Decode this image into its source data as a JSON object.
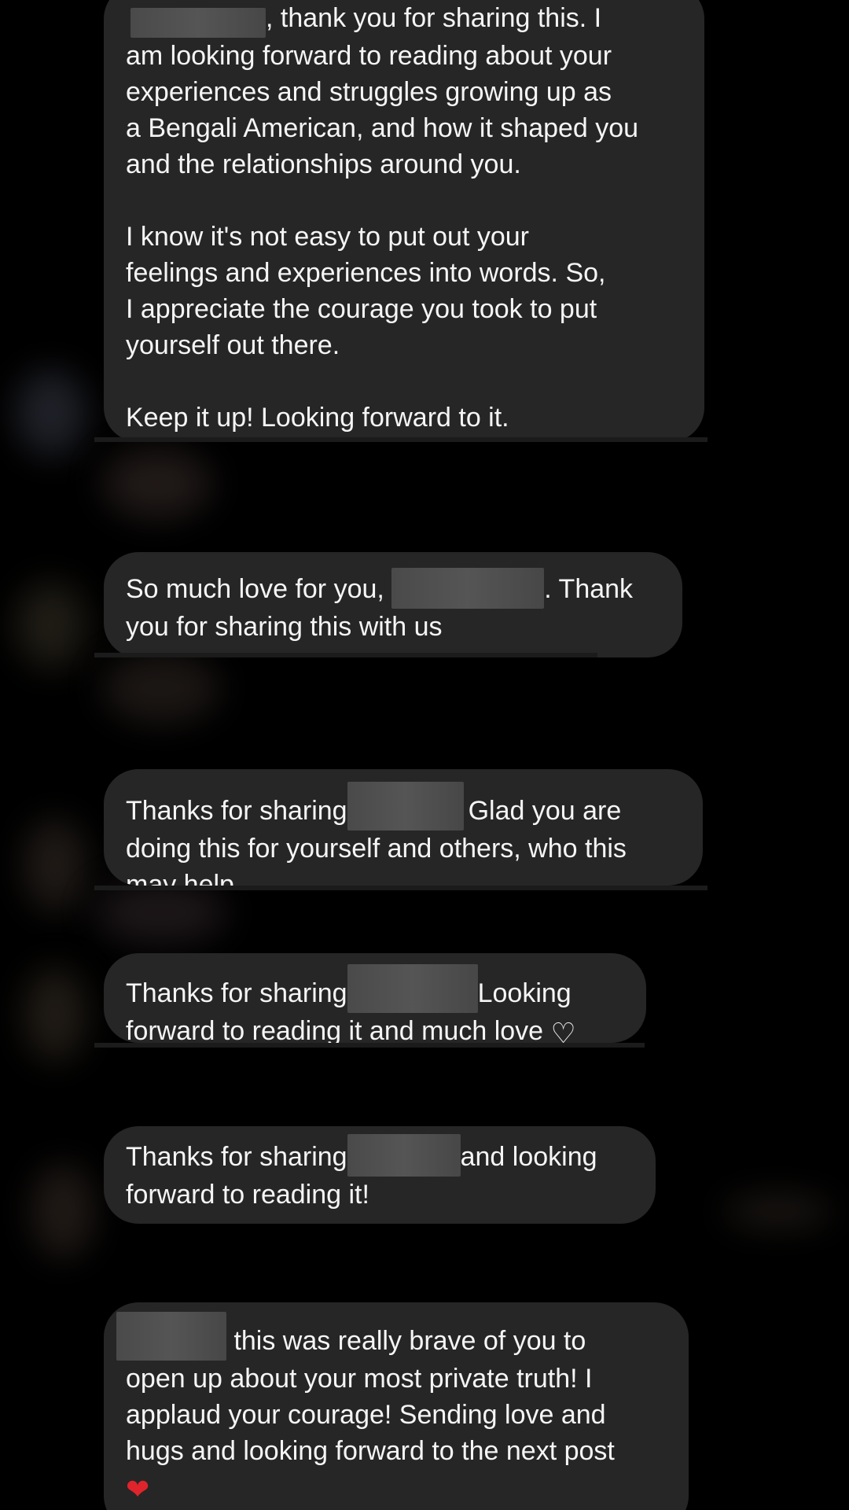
{
  "colors": {
    "background": "#000000",
    "bubble": "#262626",
    "text": "#f5f5f5",
    "redaction": "#4d4d4d",
    "heart_red": "#e0242c",
    "heart_white": "#f0f0f0"
  },
  "messages": [
    {
      "lines": [
        ", thank you for sharing this. I",
        "am looking forward to reading about your",
        "experiences and struggles growing up as",
        "a Bengali American, and how it shaped you",
        "and the relationships around you.",
        "",
        "I know it's not easy to put out your",
        "feelings and experiences into words. So,",
        "I appreciate the courage you took to put",
        "yourself out there.",
        "",
        "Keep it up! Looking forward to it."
      ]
    },
    {
      "part1": "So much love for you, ",
      "part2": ". Thank",
      "line2": "you for sharing this with us"
    },
    {
      "part1": "Thanks for sharing",
      "part2": "Glad you are",
      "line2": "doing this for yourself and others, who this",
      "line3": "may help."
    },
    {
      "part1": "Thanks for sharing",
      "part2": "Looking",
      "line2": "forward to reading it and much love",
      "emoji": "white-heart-icon",
      "emoji_glyph": "♡"
    },
    {
      "part1": "Thanks for sharing",
      "part2": "and looking",
      "line2": "forward to reading it!"
    },
    {
      "part2": " this was really brave of you to",
      "line2": "open up about your most private truth! I",
      "line3": "applaud your courage! Sending love and",
      "line4": "hugs and looking forward to the next post",
      "emoji": "red-heart-icon",
      "emoji_glyph": "❤"
    }
  ]
}
